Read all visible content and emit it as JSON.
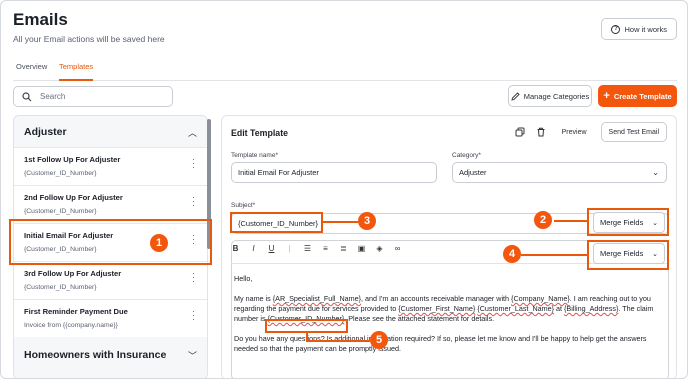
{
  "header": {
    "title": "Emails",
    "subtitle": "All your Email actions will be saved here",
    "how_it_works": "How it works"
  },
  "tabs": [
    {
      "label": "Overview",
      "active": false
    },
    {
      "label": "Templates",
      "active": true
    }
  ],
  "search": {
    "placeholder": "Search"
  },
  "actions": {
    "manage_categories": "Manage Categories",
    "create_template": "Create Template"
  },
  "sidebar": {
    "group1": {
      "title": "Adjuster",
      "expanded": true
    },
    "items": [
      {
        "title": "1st Follow Up For Adjuster",
        "sub": "{Customer_ID_Number}"
      },
      {
        "title": "2nd Follow Up For Adjuster",
        "sub": "{Customer_ID_Number}"
      },
      {
        "title": "Initial Email For Adjuster",
        "sub": "{Customer_ID_Number}"
      },
      {
        "title": "3rd Follow Up For Adjuster",
        "sub": "{Customer_ID_Number}"
      },
      {
        "title": "First Reminder Payment Due",
        "sub": "Invoice from {{company.name}}"
      }
    ],
    "group2": {
      "title": "Homeowners with Insurance",
      "expanded": false
    }
  },
  "editor": {
    "title": "Edit Template",
    "preview": "Preview",
    "send_test": "Send Test Email",
    "template_name_label": "Template name*",
    "template_name_value": "Initial Email For Adjuster",
    "category_label": "Category*",
    "category_value": "Adjuster",
    "subject_label": "Subject*",
    "subject_value": "{Customer_ID_Number}",
    "merge_fields": "Merge Fields",
    "body": {
      "greeting": "Hello,",
      "p1_a": "My name is ",
      "p1_t1": "{AR_Specialist_Full_Name}",
      "p1_b": ", and I'm an accounts receivable manager with ",
      "p1_t2": "{Company_Name}",
      "p1_c": ". I am reaching out to you regarding the payment due for services provided to ",
      "p1_t3": "{Customer_First_Name}",
      "p1_d": " ",
      "p1_t4": "{Customer_Last_Name}",
      "p1_e": " at ",
      "p1_t5": "{Billing_Address}",
      "p1_f": ". The claim number is ",
      "p1_t6": "{Customer_ID_Number}",
      "p1_g": ". Please see the attached statement for details.",
      "p2": "Do you have any questions? Is additional information required? If so, please let me know and I'll be happy to help get the answers needed so that the payment can be promptly issued."
    }
  },
  "annotations": [
    "1",
    "2",
    "3",
    "4",
    "5"
  ],
  "colors": {
    "accent": "#f2570d",
    "tab_active": "#e8590c"
  }
}
